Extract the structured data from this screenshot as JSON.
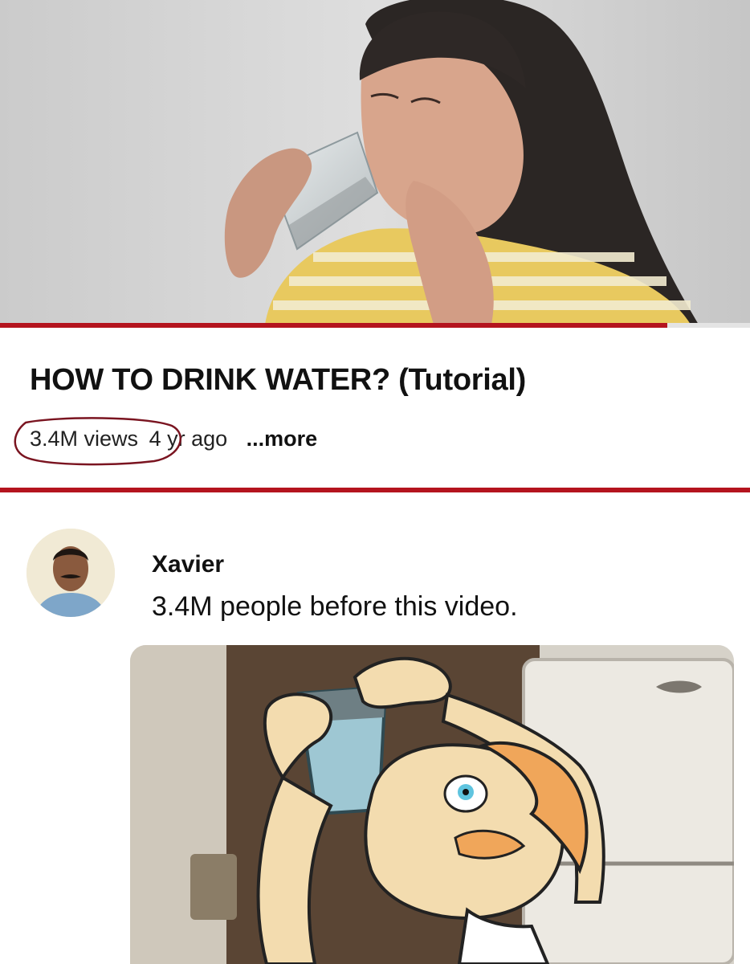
{
  "video": {
    "title": "HOW TO DRINK WATER? (Tutorial)",
    "views": "3.4M views",
    "age": "4 yr ago",
    "more_label": "...more",
    "progress": 0.89
  },
  "comment": {
    "author": "Xavier",
    "text": "3.4M people before this video."
  },
  "colors": {
    "accent_red": "#b4141e",
    "circle_annotation": "#7a1420",
    "text_primary": "#111111"
  },
  "icons": {
    "avatar": "user-avatar",
    "video": "video-thumbnail",
    "reaction": "cartoon-reaction-image"
  }
}
